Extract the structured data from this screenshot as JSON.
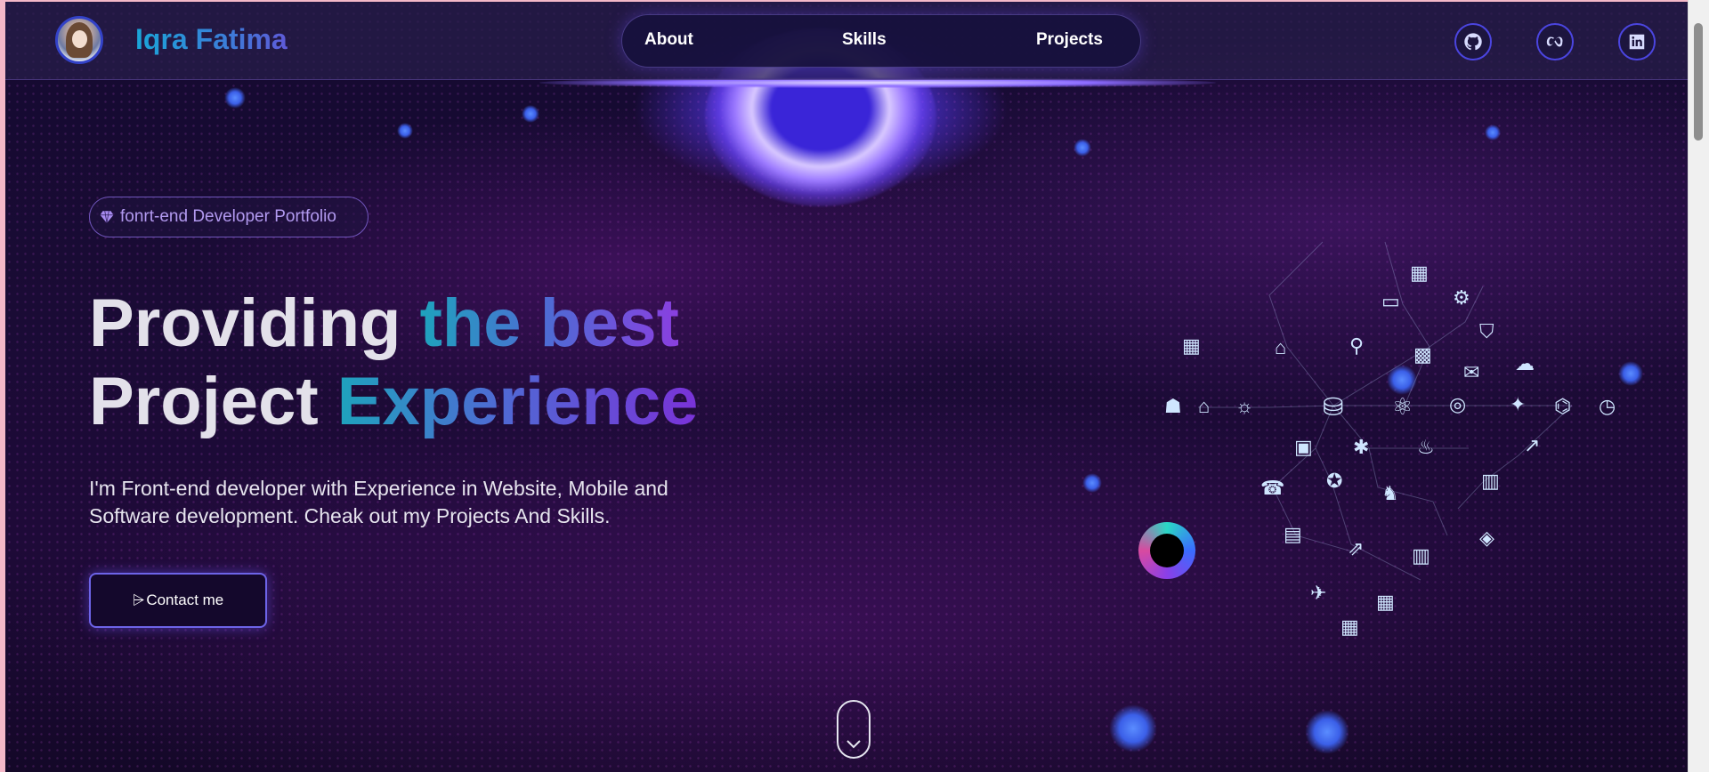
{
  "brand": {
    "name": "Iqra Fatima"
  },
  "nav": {
    "links": [
      "About",
      "Skills",
      "Projects"
    ]
  },
  "social": {
    "icons": [
      "github-icon",
      "meta-icon",
      "linkedin-icon"
    ]
  },
  "hero": {
    "badge": "fonrt-end Developer Portfolio",
    "headline_part1": "Providing ",
    "headline_part2": "the best",
    "headline_part3": "Project ",
    "headline_part4": "Experience",
    "description": "I'm Front-end developer with Experience in Website, Mobile and Software development. Cheak out my Projects And Skills.",
    "contact_arrow": "⩥",
    "contact_label": "Contact me"
  },
  "colors": {
    "accent_cyan": "#1ea3bd",
    "accent_purple": "#8a3fe0",
    "navbar_bg": "#281e4b",
    "button_border": "#6d64e8"
  },
  "network_icons": [
    "⚙",
    "⛁",
    "⚛",
    "☎",
    "⌂",
    "✦",
    "◎",
    "☗",
    "✉",
    "▦",
    "⌖",
    "☼",
    "◈",
    "⚑",
    "✈",
    "♨",
    "⚲",
    "⌬"
  ]
}
